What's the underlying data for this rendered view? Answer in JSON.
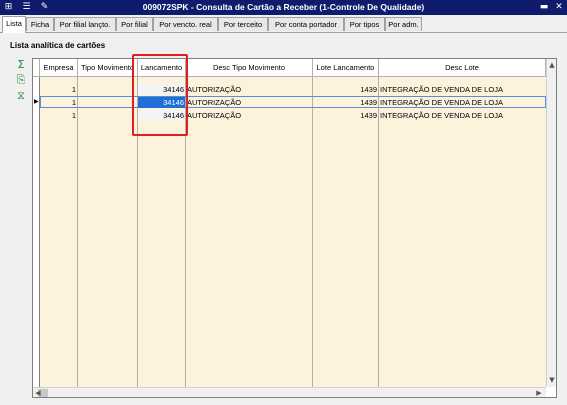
{
  "window": {
    "title": "009072SPK - Consulta de Cartão a Receber (1-Controle De Qualidade)"
  },
  "tabs": [
    "Lista",
    "Ficha",
    "Por filial lançto.",
    "Por filial",
    "Por vencto. real",
    "Por terceito",
    "Por conta portador",
    "Por tipos",
    "Por adm."
  ],
  "section_title": "Lista analítica de cartões",
  "columns": [
    "Empresa",
    "Tipo Movimento",
    "Lancamento",
    "Desc Tipo Movimento",
    "Lote Lancamento",
    "Desc Lote"
  ],
  "rows": [
    [
      "1",
      "",
      "34146",
      "AUTORIZAÇÃO",
      "1439",
      "INTEGRAÇÃO DE VENDA DE LOJA"
    ],
    [
      "1",
      "",
      "34146",
      "AUTORIZAÇÃO",
      "1439",
      "INTEGRAÇÃO DE VENDA DE LOJA"
    ],
    [
      "1",
      "",
      "34146",
      "AUTORIZAÇÃO",
      "1439",
      "INTEGRAÇÃO DE VENDA DE LOJA"
    ]
  ],
  "selected_row_index": 1,
  "icons": [
    "app-menu-icon",
    "settings-icon",
    "wrench-icon",
    "sum-icon",
    "export-icon",
    "filter-icon",
    "minimize-icon",
    "close-icon"
  ],
  "colors": {
    "titlebar": "#0f1c6e",
    "grid_background": "#fdf3dc",
    "selection": "#1e6fd6",
    "highlight_box": "#e02020"
  }
}
